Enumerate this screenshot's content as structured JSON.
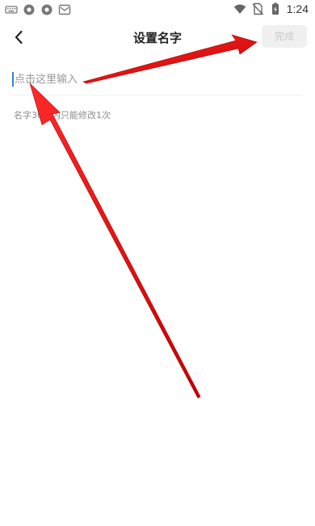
{
  "status_bar": {
    "time": "1:24",
    "left_icons": [
      "keyboard-icon",
      "circle-app-icon",
      "circle-app-icon-2",
      "mail-app-icon"
    ],
    "right_icons": [
      "wifi-icon",
      "no-sim-icon",
      "battery-icon"
    ]
  },
  "nav": {
    "back_icon": "chevron-left-icon",
    "title": "设置名字",
    "done_label": "完成"
  },
  "input": {
    "value": "",
    "placeholder": "点击这里输入"
  },
  "hint": "名字30天内只能修改1次",
  "annotations": {
    "color": "#e01010",
    "arrows": [
      "to-done-button",
      "to-name-input"
    ]
  }
}
